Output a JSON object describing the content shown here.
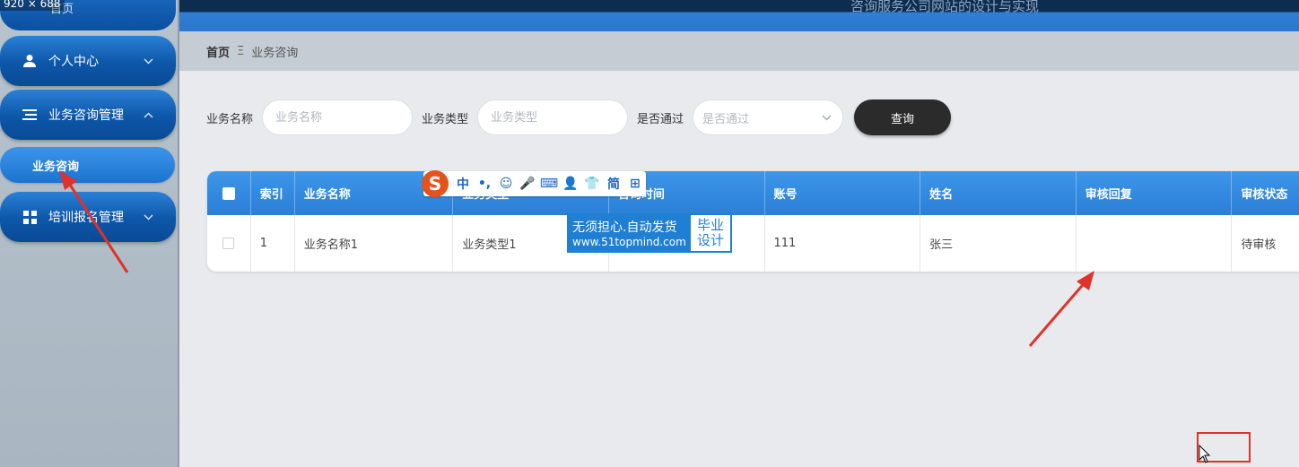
{
  "screen_dimensions_label": "920 × 688",
  "sidebar": {
    "home_label": "首页",
    "items": [
      {
        "label": "个人中心",
        "icon": "user-icon"
      },
      {
        "label": "业务咨询管理",
        "icon": "list-icon"
      },
      {
        "label": "培训报名管理",
        "icon": "grid-icon"
      }
    ],
    "sub_item": "业务咨询"
  },
  "header": {
    "title": "咨询服务公司网站的设计与实现"
  },
  "breadcrumb": {
    "home": "首页",
    "separator": "Ξ",
    "current": "业务咨询"
  },
  "search": {
    "name_label": "业务名称",
    "name_placeholder": "业务名称",
    "type_label": "业务类型",
    "type_placeholder": "业务类型",
    "pass_label": "是否通过",
    "pass_placeholder": "是否通过",
    "query_button": "查询"
  },
  "table": {
    "headers": [
      "索引",
      "业务名称",
      "业务类型",
      "咨询时间",
      "账号",
      "姓名",
      "审核回复",
      "审核状态"
    ],
    "rows": [
      [
        "1",
        "业务名称1",
        "业务类型1",
        "",
        "111",
        "张三",
        "",
        "待审核"
      ]
    ]
  },
  "ime_toolbar": {
    "logo": "S",
    "items": [
      "中",
      "•,",
      "☺",
      "🎤",
      "⌨",
      "👤",
      "👕",
      "简",
      "⊞"
    ]
  },
  "ad": {
    "line1": "无须担心.自动发货",
    "line2": "www.51topmind.com",
    "right_line1": "毕业",
    "right_line2": "设计"
  },
  "colors": {
    "accent": "#2a7fd6",
    "sidebar_button": "#0d56a8",
    "annotation": "#e0312a"
  }
}
